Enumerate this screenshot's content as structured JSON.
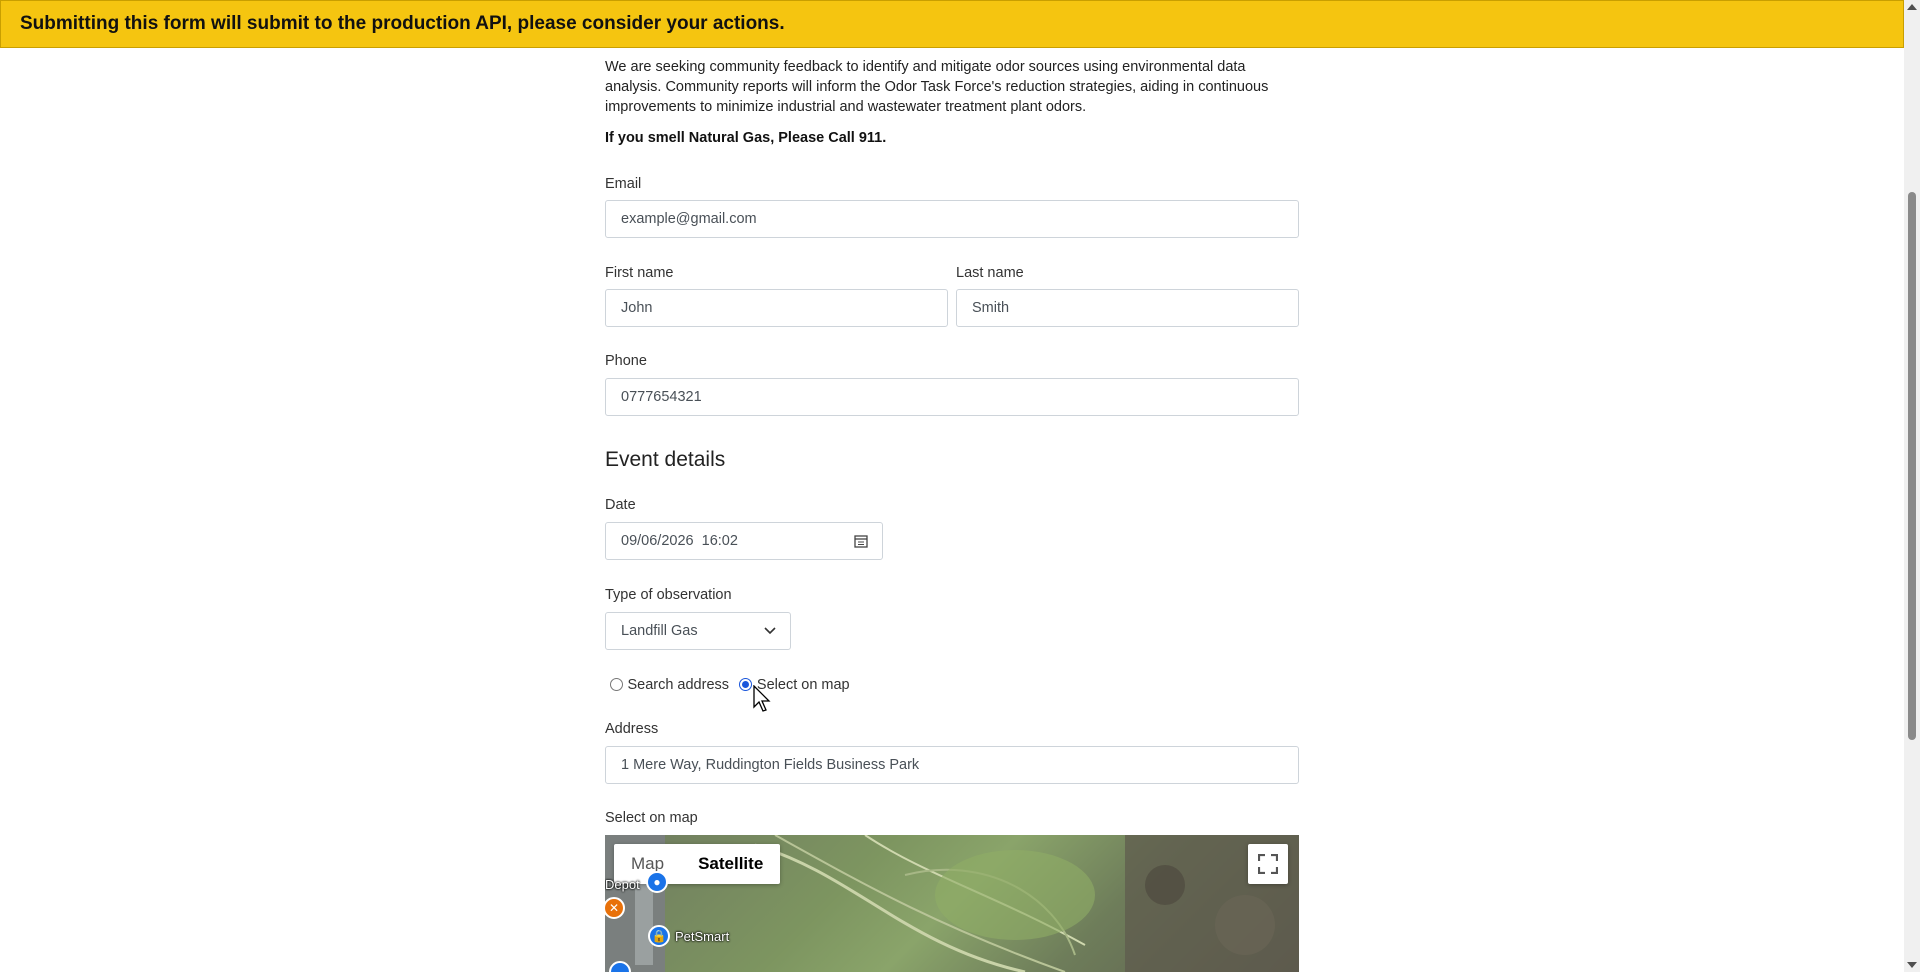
{
  "banner": {
    "text": "Submitting this form will submit to the production API, please consider your actions."
  },
  "intro": {
    "text": "We are seeking community feedback to identify and mitigate odor sources using environmental data analysis. Community reports will inform the Odor Task Force's reduction strategies, aiding in continuous improvements to minimize industrial and wastewater treatment plant odors.",
    "warning": "If you smell Natural Gas, Please Call 911."
  },
  "contact": {
    "email_label": "Email",
    "email_placeholder": "example@gmail.com",
    "first_name_label": "First name",
    "first_name_placeholder": "John",
    "last_name_label": "Last name",
    "last_name_placeholder": "Smith",
    "phone_label": "Phone",
    "phone_placeholder": "0777654321"
  },
  "event": {
    "section_title": "Event details",
    "date_label": "Date",
    "date_value": "09/06/2026  16:02",
    "type_label": "Type of observation",
    "type_value": "Landfill Gas",
    "radio_search": "Search address",
    "radio_map": "Select on map",
    "radio_selected": "Select on map",
    "address_label": "Address",
    "address_value": "1 Mere Way, Ruddington Fields Business Park",
    "map_label": "Select on map"
  },
  "map": {
    "map_button": "Map",
    "satellite_button": "Satellite",
    "active_view": "Satellite",
    "places": [
      "Depot",
      "PetSmart"
    ]
  },
  "colors": {
    "banner": "#f5c510",
    "radio_accent": "#1a56db"
  }
}
